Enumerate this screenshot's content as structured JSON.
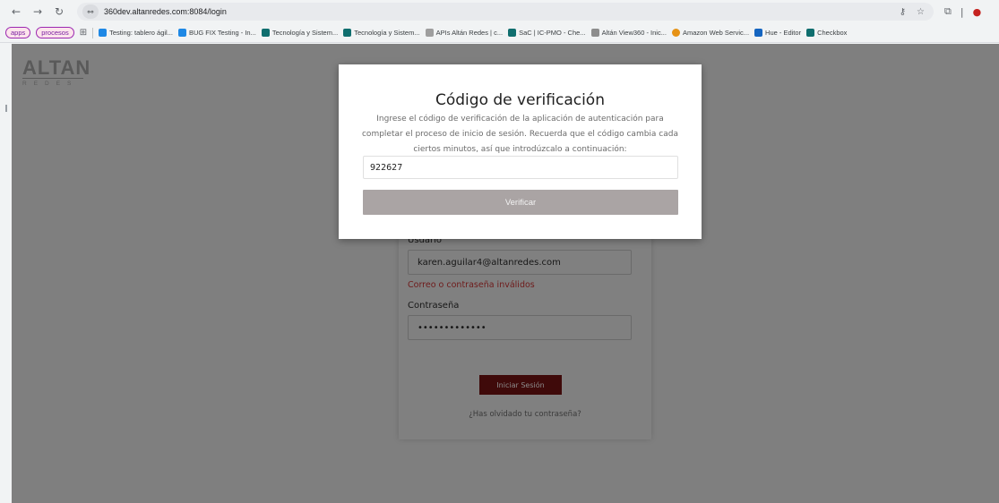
{
  "browser": {
    "url": "360dev.altanredes.com:8084/login",
    "site_info_icon": "⚯",
    "bookmarks_chips": [
      "apps",
      "procesos"
    ],
    "bookmarks": [
      {
        "label": "Testing: tablero ágil...",
        "icon_color": "#1e88e5"
      },
      {
        "label": "BUG FIX Testing - In...",
        "icon_color": "#1e88e5"
      },
      {
        "label": "Tecnología y Sistem...",
        "icon_color": "#0f6e6e"
      },
      {
        "label": "Tecnología y Sistem...",
        "icon_color": "#0f6e6e"
      },
      {
        "label": "APIs Altán Redes | c...",
        "icon_color": "#9e9e9e"
      },
      {
        "label": "SaC | IC-PMO - Che...",
        "icon_color": "#0f6e6e"
      },
      {
        "label": "Altán View360 - Inic...",
        "icon_color": "#8d8d8d"
      },
      {
        "label": "Amazon Web Servic...",
        "icon_color": "#e69215"
      },
      {
        "label": "Hue - Editor",
        "icon_color": "#1565c0"
      },
      {
        "label": "Checkbox",
        "icon_color": "#0f6e6e"
      }
    ]
  },
  "logo": {
    "main": "ALTAN",
    "sub": "REDES"
  },
  "login": {
    "user_label": "Usuario",
    "user_value": "karen.aguilar4@altanredes.com",
    "error": "Correo o contraseña inválidos",
    "password_label": "Contraseña",
    "password_value": "•••••••••••••",
    "submit": "Iniciar Sesión",
    "forgot": "¿Has olvidado tu contraseña?"
  },
  "modal": {
    "title": "Código de verificación",
    "description": "Ingrese el código de verificación de la aplicación de autenticación para completar el proceso de inicio de sesión. Recuerda que el código cambia cada ciertos minutos, así que introdúzcalo a continuación:",
    "code_value": "922627",
    "verify_button": "Verificar"
  },
  "colors": {
    "overlay": "#7f7f7f",
    "verify_button": "#aaa4a4",
    "error_text": "#6e1a1a",
    "login_button": "#3f0a0a"
  }
}
